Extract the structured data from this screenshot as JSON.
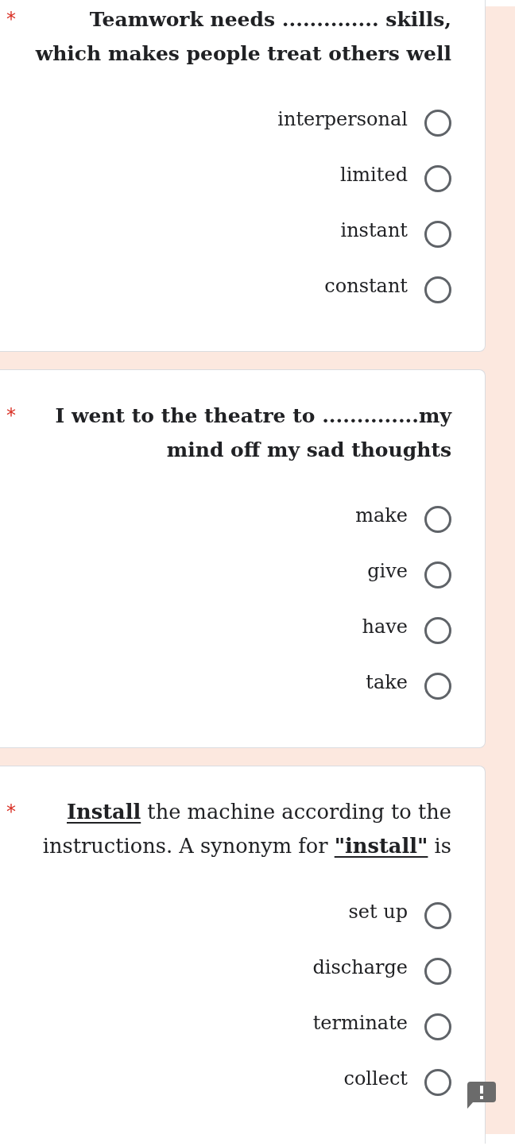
{
  "questions": [
    {
      "required_mark": "*",
      "title": "Teamwork needs .............. skills, which makes people treat others well",
      "title_bold": true,
      "options": [
        {
          "label": "interpersonal",
          "selected": false
        },
        {
          "label": "limited",
          "selected": false
        },
        {
          "label": "instant",
          "selected": false
        },
        {
          "label": "constant",
          "selected": false
        }
      ]
    },
    {
      "required_mark": "*",
      "title": "I went to the theatre to ..............my mind off my sad thoughts",
      "title_bold": true,
      "options": [
        {
          "label": "make",
          "selected": false
        },
        {
          "label": "give",
          "selected": false
        },
        {
          "label": "have",
          "selected": false
        },
        {
          "label": "take",
          "selected": false
        }
      ]
    },
    {
      "required_mark": "*",
      "title": "**Install** the machine according to the instructions. A synonym for **\"install\"** is",
      "title_bold": false,
      "options": [
        {
          "label": "set up",
          "selected": false
        },
        {
          "label": "discharge",
          "selected": false
        },
        {
          "label": "terminate",
          "selected": false
        },
        {
          "label": "collect",
          "selected": false
        }
      ]
    }
  ]
}
